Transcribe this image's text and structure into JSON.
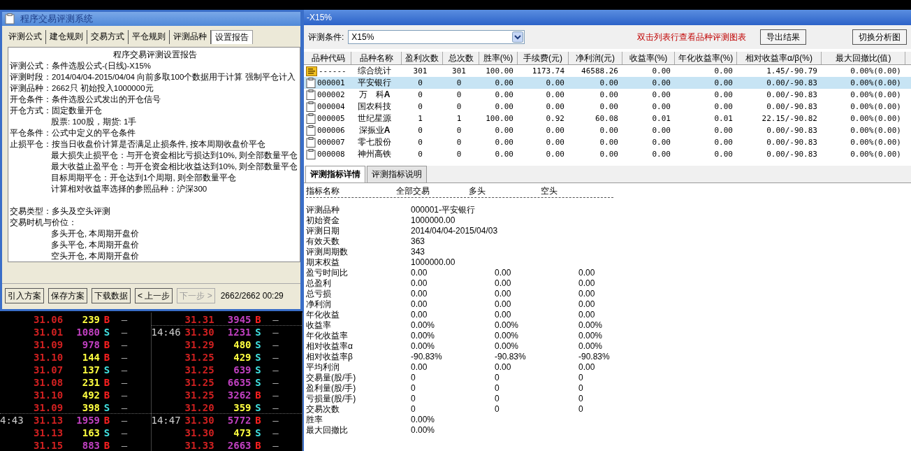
{
  "left_window": {
    "title": "程序交易评测系统",
    "tabs": [
      {
        "label": "评测公式",
        "selected": false
      },
      {
        "label": "建仓规则",
        "selected": false
      },
      {
        "label": "交易方式",
        "selected": false
      },
      {
        "label": "平仓规则",
        "selected": false
      },
      {
        "label": "评测品种",
        "selected": false
      },
      {
        "label": "设置报告",
        "selected": true
      }
    ],
    "report": {
      "title": "程序交易评测设置报告",
      "sections": [
        [
          {
            "label": "评测公式：",
            "text": "条件选股公式-(日线)-X15%"
          },
          {
            "label": "评测时段：",
            "text": "2014/04/04-2015/04/04 向前多取100个数据用于计算 强制平仓计入"
          },
          {
            "label": "评测品种：",
            "text": "2662只 初始投入1000000元"
          },
          {
            "label": "开仓条件：",
            "text": "条件选股公式发出的开仓信号"
          },
          {
            "label": "开仓方式：",
            "text": "固定数量开仓"
          },
          {
            "text": "股票: 100股，期货: 1手"
          },
          {
            "label": "平仓条件：",
            "text": "公式中定义的平仓条件"
          },
          {
            "label": "止损平仓：",
            "text": "按当日收盘价计算是否满足止损条件, 按本周期收盘价平仓"
          },
          {
            "text": "最大损失止损平仓：与开仓资金相比亏损达到10%, 则全部数量平仓"
          },
          {
            "text": "最大收益止盈平仓：与开仓资金相比收益达到10%, 则全部数量平仓"
          },
          {
            "text": "目标周期平仓：开仓达到1个周期, 则全部数量平仓"
          },
          {
            "text": "计算相对收益率选择的参照品种：沪深300"
          }
        ],
        [
          {
            "label": "交易类型：",
            "text": "多头及空头评测"
          },
          {
            "label": "交易时机与价位："
          },
          {
            "text": "多头开仓, 本周期开盘价"
          },
          {
            "text": "多头平仓, 本周期开盘价"
          },
          {
            "text": "空头开仓, 本周期开盘价"
          }
        ]
      ]
    },
    "buttons": [
      {
        "label": "引入方案",
        "disabled": false
      },
      {
        "label": "保存方案",
        "disabled": false
      },
      {
        "label": "下载数据",
        "disabled": false
      },
      {
        "label": "< 上一步",
        "disabled": false
      },
      {
        "label": "下一步 >",
        "disabled": true
      }
    ],
    "status": "2662/2662 00:29"
  },
  "ticker": {
    "columns": [
      [
        {
          "price": "31.06",
          "volume": "239",
          "color": "#ffff40",
          "side": "B",
          "kind": "buy",
          "mark": "—"
        },
        {
          "price": "31.01",
          "volume": "1080",
          "color": "#c040c0",
          "side": "S",
          "kind": "sell",
          "mark": "—"
        },
        {
          "price": "31.09",
          "volume": "978",
          "color": "#c040c0",
          "side": "B",
          "kind": "buy",
          "mark": "—"
        },
        {
          "price": "31.10",
          "volume": "144",
          "color": "#ffff40",
          "side": "B",
          "kind": "buy",
          "mark": "—"
        },
        {
          "price": "31.07",
          "volume": "137",
          "color": "#ffff40",
          "side": "S",
          "kind": "sell",
          "mark": "—"
        },
        {
          "price": "31.08",
          "volume": "231",
          "color": "#ffff40",
          "side": "B",
          "kind": "buy",
          "mark": "—"
        },
        {
          "price": "31.10",
          "volume": "492",
          "color": "#ffff40",
          "side": "B",
          "kind": "buy",
          "mark": "—"
        },
        {
          "price": "31.09",
          "volume": "398",
          "color": "#ffff40",
          "side": "S",
          "kind": "sell",
          "mark": "—"
        },
        {
          "time": "4:43",
          "price": "31.13",
          "volume": "1959",
          "color": "#c040c0",
          "side": "B",
          "kind": "buy",
          "mark": "—"
        },
        {
          "price": "31.13",
          "volume": "163",
          "color": "#ffff40",
          "side": "S",
          "kind": "sell",
          "mark": "—"
        },
        {
          "price": "31.15",
          "volume": "883",
          "color": "#c040c0",
          "side": "B",
          "kind": "buy",
          "mark": "—"
        }
      ],
      [
        {
          "price": "31.31",
          "volume": "3945",
          "color": "#c040c0",
          "side": "B",
          "kind": "buy",
          "mark": "—"
        },
        {
          "time": "14:46",
          "price": "31.30",
          "volume": "1231",
          "color": "#c040c0",
          "side": "S",
          "kind": "sell",
          "mark": "—"
        },
        {
          "price": "31.29",
          "volume": "480",
          "color": "#ffff40",
          "side": "S",
          "kind": "sell",
          "mark": "—"
        },
        {
          "price": "31.25",
          "volume": "429",
          "color": "#ffff40",
          "side": "S",
          "kind": "sell",
          "mark": "—"
        },
        {
          "price": "31.25",
          "volume": "639",
          "color": "#c040c0",
          "side": "S",
          "kind": "sell",
          "mark": "—"
        },
        {
          "price": "31.25",
          "volume": "6635",
          "color": "#c040c0",
          "side": "S",
          "kind": "sell",
          "mark": "—"
        },
        {
          "price": "31.25",
          "volume": "3262",
          "color": "#c040c0",
          "side": "B",
          "kind": "buy",
          "mark": "—"
        },
        {
          "price": "31.20",
          "volume": "359",
          "color": "#ffff40",
          "side": "S",
          "kind": "sell",
          "mark": "—"
        },
        {
          "time": "14:47",
          "price": "31.30",
          "volume": "5772",
          "color": "#c040c0",
          "side": "B",
          "kind": "buy",
          "mark": "—"
        },
        {
          "price": "31.30",
          "volume": "473",
          "color": "#ffff40",
          "side": "S",
          "kind": "sell",
          "mark": "—"
        },
        {
          "price": "31.33",
          "volume": "2663",
          "color": "#c040c0",
          "side": "B",
          "kind": "buy",
          "mark": "—"
        }
      ]
    ]
  },
  "right_window": {
    "title": "-X15%",
    "condition": {
      "label": "评测条件:",
      "value": "X15%"
    },
    "hint": "双击列表行查看品种评测图表",
    "buttons": [
      "导出结果",
      "切换分析图"
    ],
    "table": {
      "columns": [
        "品种代码",
        "品种名称",
        "盈利次数",
        "总次数",
        "胜率(%)",
        "手续费(元)",
        "净利润(元)",
        "收益率(%)",
        "年化收益率(%)",
        "相对收益率α/β(%)",
        "最大回撤比(值)"
      ],
      "rows": [
        {
          "kind": "summary",
          "selected": false,
          "cells": [
            "------",
            "综合统计",
            "301",
            "301",
            "100.00",
            "1173.74",
            "46588.26",
            "0.00",
            "0.00",
            "1.45/-90.79",
            "0.00%(0.00)"
          ]
        },
        {
          "kind": "item",
          "selected": true,
          "cells": [
            "000001",
            "平安银行",
            "0",
            "0",
            "0.00",
            "0.00",
            "0.00",
            "0.00",
            "0.00",
            "0.00/-90.83",
            "0.00%(0.00)"
          ]
        },
        {
          "kind": "item",
          "selected": false,
          "cells": [
            "000002",
            "万　科**A**",
            "0",
            "0",
            "0.00",
            "0.00",
            "0.00",
            "0.00",
            "0.00",
            "0.00/-90.83",
            "0.00%(0.00)"
          ]
        },
        {
          "kind": "item",
          "selected": false,
          "cells": [
            "000004",
            "国农科技",
            "0",
            "0",
            "0.00",
            "0.00",
            "0.00",
            "0.00",
            "0.00",
            "0.00/-90.83",
            "0.00%(0.00)"
          ]
        },
        {
          "kind": "item",
          "selected": false,
          "cells": [
            "000005",
            "世纪星源",
            "1",
            "1",
            "100.00",
            "0.92",
            "60.08",
            "0.01",
            "0.01",
            "22.15/-90.82",
            "0.00%(0.00)"
          ]
        },
        {
          "kind": "item",
          "selected": false,
          "cells": [
            "000006",
            "深振业**A**",
            "0",
            "0",
            "0.00",
            "0.00",
            "0.00",
            "0.00",
            "0.00",
            "0.00/-90.83",
            "0.00%(0.00)"
          ]
        },
        {
          "kind": "item",
          "selected": false,
          "cells": [
            "000007",
            "零七股份",
            "0",
            "0",
            "0.00",
            "0.00",
            "0.00",
            "0.00",
            "0.00",
            "0.00/-90.83",
            "0.00%(0.00)"
          ]
        },
        {
          "kind": "item",
          "selected": false,
          "cells": [
            "000008",
            "神州高铁",
            "0",
            "0",
            "0.00",
            "0.00",
            "0.00",
            "0.00",
            "0.00",
            "0.00/-90.83",
            "0.00%(0.00)"
          ]
        }
      ]
    },
    "tabs": [
      {
        "label": "评测指标详情",
        "selected": true
      },
      {
        "label": "评测指标说明",
        "selected": false
      }
    ],
    "details": {
      "header": [
        "指标名称",
        "全部交易",
        "多头",
        "空头"
      ],
      "rows": [
        [
          "评测品种",
          "000001-平安银行"
        ],
        [
          "初始资金",
          "1000000.00"
        ],
        [
          "评测日期",
          "2014/04/04-2015/04/03"
        ],
        [
          "有效天数",
          "363"
        ],
        [
          "评测周期数",
          "343"
        ],
        [
          "期末权益",
          "1000000.00"
        ],
        [
          "盈亏时间比",
          "0.00",
          "0.00",
          "0.00"
        ],
        [
          "总盈利",
          "0.00",
          "0.00",
          "0.00"
        ],
        [
          "总亏损",
          "0.00",
          "0.00",
          "0.00"
        ],
        [
          "净利润",
          "0.00",
          "0.00",
          "0.00"
        ],
        [
          "年化收益",
          "0.00",
          "0.00",
          "0.00"
        ],
        [
          "收益率",
          "0.00%",
          "0.00%",
          "0.00%"
        ],
        [
          "年化收益率",
          "0.00%",
          "0.00%",
          "0.00%"
        ],
        [
          "相对收益率α",
          "0.00%",
          "0.00%",
          "0.00%"
        ],
        [
          "相对收益率β",
          "-90.83%",
          "-90.83%",
          "-90.83%"
        ],
        [
          "平均利润",
          "0.00",
          "0.00",
          "0.00"
        ],
        [
          "交易量(股/手)",
          "0",
          "0",
          "0"
        ],
        [
          "盈利量(股/手)",
          "0",
          "0",
          "0"
        ],
        [
          "亏损量(股/手)",
          "0",
          "0",
          "0"
        ],
        [
          "交易次数",
          "0",
          "0",
          "0"
        ],
        [
          "胜率",
          "0.00%"
        ],
        [
          "最大回撤比",
          "0.00%"
        ]
      ]
    }
  }
}
